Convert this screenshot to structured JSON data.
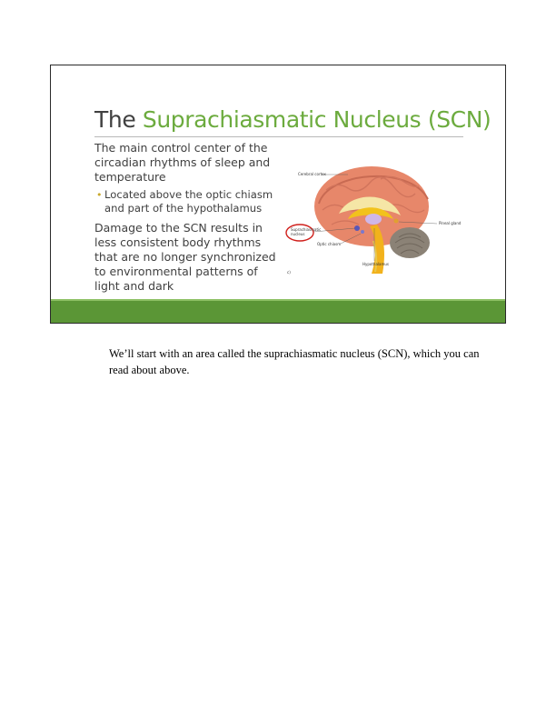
{
  "slide": {
    "title_prefix": "The ",
    "title_highlight": "Suprachiasmatic Nucleus (SCN)",
    "paragraph1": "The main control center of the circadian rhythms of sleep and temperature",
    "bullet1": "Located above the optic chiasm and part of the hypothalamus",
    "paragraph2": "Damage to the SCN results in less consistent body rhythms that are no longer synchronized to environmental patterns of light and dark",
    "figure": {
      "label_cerebral_cortex": "Cerebral cortex",
      "label_pineal_gland": "Pineal gland",
      "label_scn_line1": "Suprachiasmatic",
      "label_scn_line2": "nucleus",
      "label_optic_chiasm": "Optic chiasm",
      "label_hypothalamus": "Hypothalamus",
      "panel_letter": "c)"
    },
    "colors": {
      "accent_green": "#6cab3e",
      "footer_green": "#5b9636",
      "bullet_gold": "#c9a82b",
      "scn_circle_red": "#d0201c"
    }
  },
  "caption": "We’ll start with an area called the suprachiasmatic nucleus (SCN), which you can read about above."
}
